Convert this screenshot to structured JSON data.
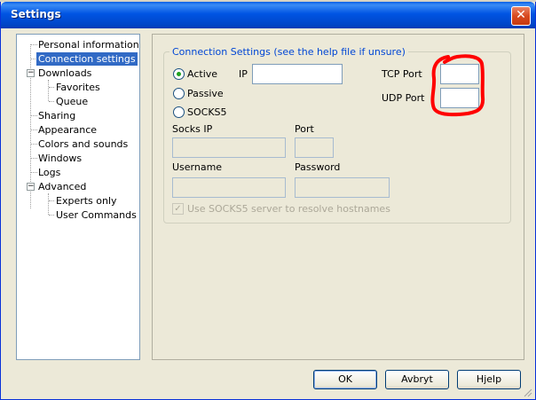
{
  "window": {
    "title": "Settings",
    "close_glyph": "✕"
  },
  "tree": [
    {
      "label": "Personal information",
      "selected": false
    },
    {
      "label": "Connection settings",
      "selected": true
    },
    {
      "label": "Downloads",
      "selected": false,
      "expander": "−"
    },
    {
      "label": "Favorites",
      "selected": false
    },
    {
      "label": "Queue",
      "selected": false
    },
    {
      "label": "Sharing",
      "selected": false
    },
    {
      "label": "Appearance",
      "selected": false
    },
    {
      "label": "Colors and sounds",
      "selected": false
    },
    {
      "label": "Windows",
      "selected": false
    },
    {
      "label": "Logs",
      "selected": false
    },
    {
      "label": "Advanced",
      "selected": false,
      "expander": "−"
    },
    {
      "label": "Experts only",
      "selected": false
    },
    {
      "label": "User Commands",
      "selected": false
    }
  ],
  "connection": {
    "group_title": "Connection Settings (see the help file if unsure)",
    "modes": [
      {
        "label": "Active",
        "checked": true
      },
      {
        "label": "Passive",
        "checked": false
      },
      {
        "label": "SOCKS5",
        "checked": false
      }
    ],
    "ip": {
      "label": "IP",
      "value": ""
    },
    "tcp_port": {
      "label": "TCP Port",
      "value": ""
    },
    "udp_port": {
      "label": "UDP Port",
      "value": ""
    },
    "socks_ip": {
      "label": "Socks IP",
      "value": ""
    },
    "socks_port": {
      "label": "Port",
      "value": ""
    },
    "username": {
      "label": "Username",
      "value": ""
    },
    "password": {
      "label": "Password",
      "value": ""
    },
    "resolve_checkbox": {
      "label": "Use SOCKS5 server to resolve hostnames",
      "checked": true,
      "enabled": false
    }
  },
  "buttons": {
    "ok": "OK",
    "cancel": "Avbryt",
    "help": "Hjelp"
  },
  "colors": {
    "titlebar": "#0054e3",
    "selection": "#316ac5",
    "group_title": "#0046d5",
    "annotation": "#ff0000"
  },
  "icons": {
    "close": "close-icon",
    "expander": "minus-icon",
    "radio": "radio-icon",
    "checkbox": "checkmark-icon"
  }
}
